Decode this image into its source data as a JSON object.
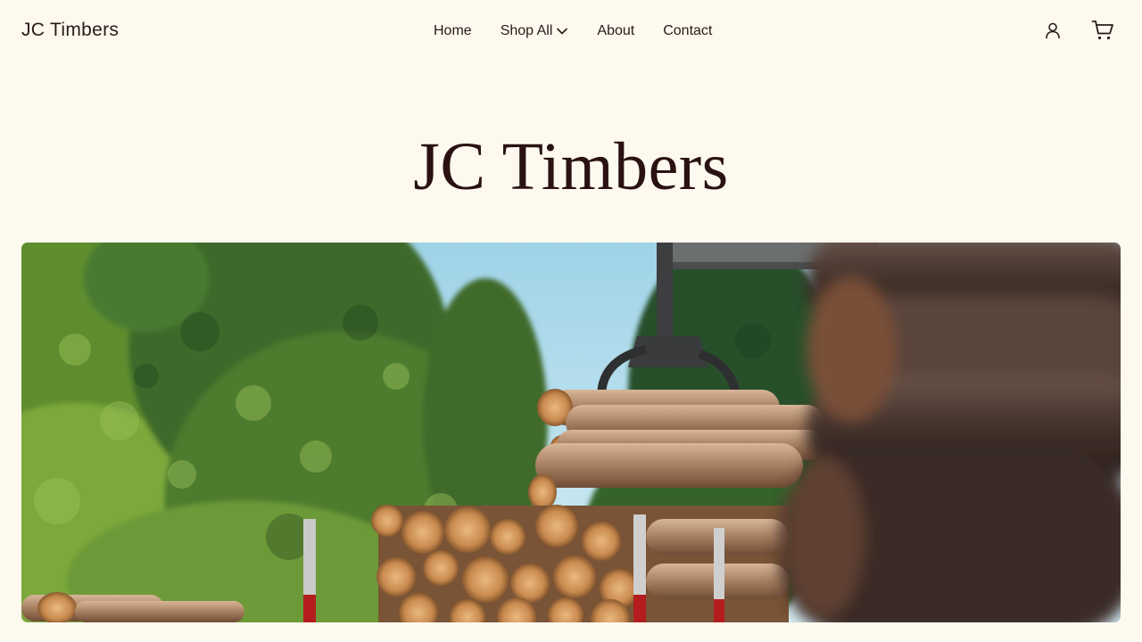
{
  "header": {
    "logo": "JC Timbers",
    "nav": [
      {
        "label": "Home"
      },
      {
        "label": "Shop All",
        "has_dropdown": true
      },
      {
        "label": "About"
      },
      {
        "label": "Contact"
      }
    ],
    "icons": {
      "account": "user-icon",
      "cart": "cart-icon"
    }
  },
  "hero": {
    "title": "JC Timbers",
    "image": "timber-logs-crane-photo"
  },
  "colors": {
    "background": "#fdf9ee",
    "text": "#2a1a18"
  }
}
